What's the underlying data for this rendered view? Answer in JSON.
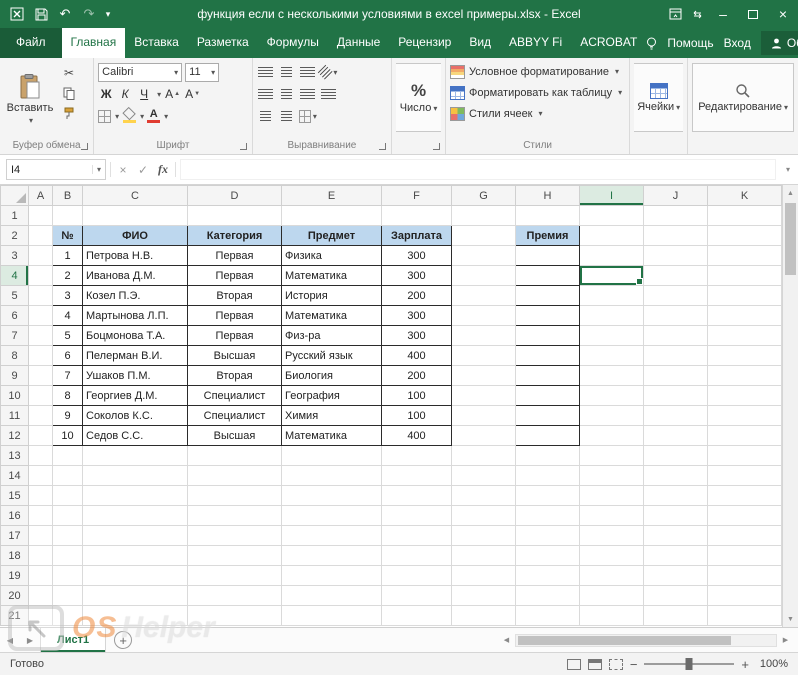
{
  "window": {
    "title": "функция если с несколькими условиями в excel примеры.xlsx - Excel"
  },
  "tabs": {
    "file": "Файл",
    "items": [
      "Главная",
      "Вставка",
      "Разметка",
      "Формулы",
      "Данные",
      "Рецензир",
      "Вид",
      "ABBYY Fi",
      "ACROBAT"
    ],
    "active": "Главная",
    "help": "Помощь",
    "signin": "Вход",
    "share": "Общий доступ"
  },
  "ribbon": {
    "paste": "Вставить",
    "clipboard_group": "Буфер обмена",
    "font_name": "Calibri",
    "font_size": "11",
    "bold": "Ж",
    "italic": "К",
    "underline": "Ч",
    "font_group": "Шрифт",
    "alignment_group": "Выравнивание",
    "percent": "%",
    "number_label": "Число",
    "styles": {
      "conditional": "Условное форматирование",
      "format_table": "Форматировать как таблицу",
      "cell_styles": "Стили ячеек",
      "group": "Стили"
    },
    "cells": "Ячейки",
    "editing": "Редактирование"
  },
  "formula_bar": {
    "name_box": "I4",
    "fx": "fx",
    "value": ""
  },
  "sheet": {
    "columns": [
      "A",
      "B",
      "C",
      "D",
      "E",
      "F",
      "G",
      "H",
      "I",
      "J",
      "K"
    ],
    "row_count": 21,
    "selected": {
      "cell": "I4",
      "col": "I",
      "row": 4
    },
    "table": {
      "header_cells": [
        {
          "col": "B",
          "text": "№"
        },
        {
          "col": "C",
          "text": "ФИО"
        },
        {
          "col": "D",
          "text": "Категория"
        },
        {
          "col": "E",
          "text": "Предмет"
        },
        {
          "col": "F",
          "text": "Зарплата"
        },
        {
          "col": "H",
          "text": "Премия"
        }
      ],
      "rows": [
        {
          "num": 1,
          "fio": "Петрова Н.В.",
          "category": "Первая",
          "subject": "Физика",
          "salary": 300
        },
        {
          "num": 2,
          "fio": "Иванова Д.М.",
          "category": "Первая",
          "subject": "Математика",
          "salary": 300
        },
        {
          "num": 3,
          "fio": "Козел П.Э.",
          "category": "Вторая",
          "subject": "История",
          "salary": 200
        },
        {
          "num": 4,
          "fio": "Мартынова Л.П.",
          "category": "Первая",
          "subject": "Математика",
          "salary": 300
        },
        {
          "num": 5,
          "fio": "Боцмонова Т.А.",
          "category": "Первая",
          "subject": "Физ-ра",
          "salary": 300
        },
        {
          "num": 6,
          "fio": "Пелерман В.И.",
          "category": "Высшая",
          "subject": "Русский язык",
          "salary": 400
        },
        {
          "num": 7,
          "fio": "Ушаков П.М.",
          "category": "Вторая",
          "subject": "Биология",
          "salary": 200
        },
        {
          "num": 8,
          "fio": "Георгиев Д.М.",
          "category": "Специалист",
          "subject": "География",
          "salary": 100
        },
        {
          "num": 9,
          "fio": "Соколов К.С.",
          "category": "Специалист",
          "subject": "Химия",
          "salary": 100
        },
        {
          "num": 10,
          "fio": "Седов С.С.",
          "category": "Высшая",
          "subject": "Математика",
          "salary": 400
        }
      ]
    }
  },
  "footer": {
    "sheet_tab": "Лист1",
    "status": "Готово",
    "zoom": "100%"
  },
  "watermark": {
    "os": "OS",
    "helper": "Helper"
  },
  "colors": {
    "accent": "#217346",
    "table_header_fill": "#BDD7EE"
  }
}
